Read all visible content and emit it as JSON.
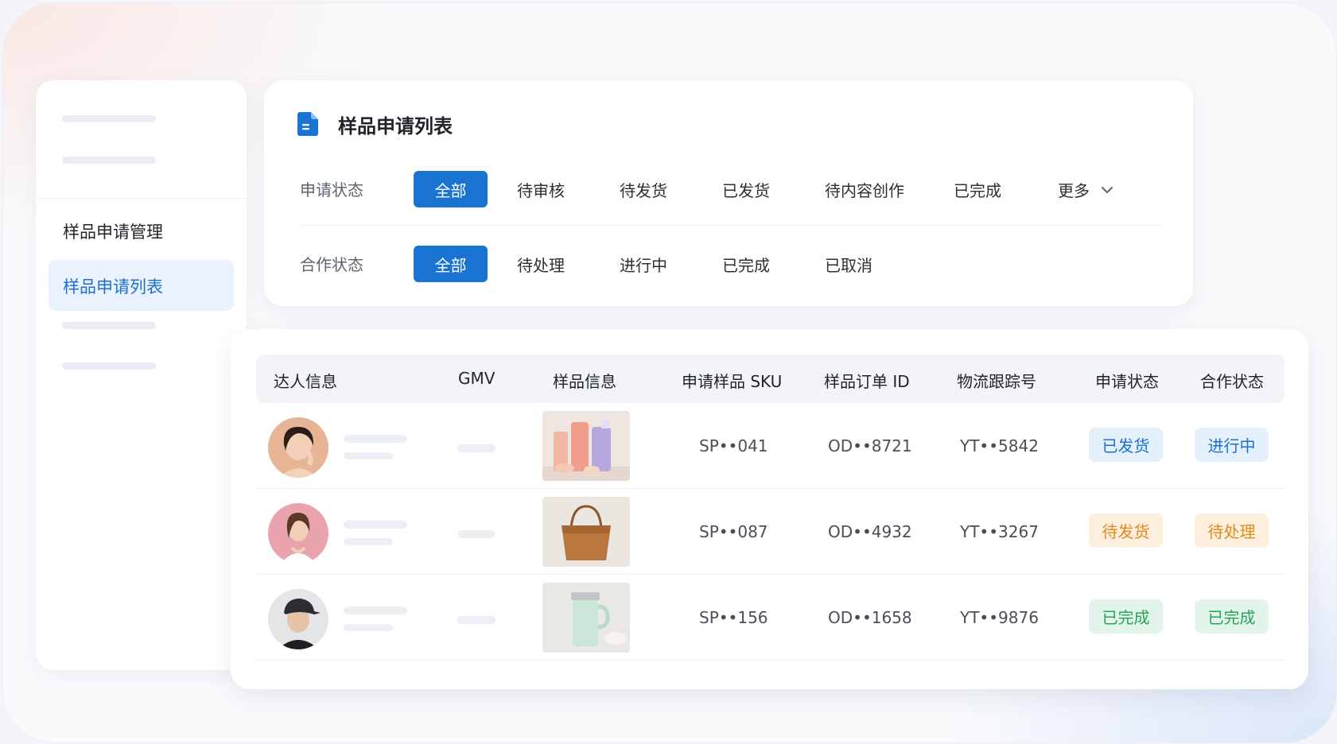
{
  "sidebar": {
    "group_title": "样品申请管理",
    "active_item": "样品申请列表"
  },
  "filters": {
    "title": "样品申请列表",
    "apply_status": {
      "label": "申请状态",
      "options": [
        "全部",
        "待审核",
        "待发货",
        "已发货",
        "待内容创作",
        "已完成"
      ],
      "selected": "全部",
      "more": "更多"
    },
    "coop_status": {
      "label": "合作状态",
      "options": [
        "全部",
        "待处理",
        "进行中",
        "已完成",
        "已取消"
      ],
      "selected": "全部"
    }
  },
  "table": {
    "columns": [
      "达人信息",
      "GMV",
      "样品信息",
      "申请样品 SKU",
      "样品订单 ID",
      "物流跟踪号",
      "申请状态",
      "合作状态"
    ],
    "rows": [
      {
        "sku": "SP••041",
        "order_id": "OD••8721",
        "tracking": "YT••5842",
        "apply_status": "已发货",
        "apply_color": "blue",
        "coop_status": "进行中",
        "coop_color": "blue",
        "product": "cosmetics",
        "avatar": "woman-1"
      },
      {
        "sku": "SP••087",
        "order_id": "OD••4932",
        "tracking": "YT••3267",
        "apply_status": "待发货",
        "apply_color": "orange",
        "coop_status": "待处理",
        "coop_color": "orange",
        "product": "tote-bag",
        "avatar": "woman-2"
      },
      {
        "sku": "SP••156",
        "order_id": "OD••1658",
        "tracking": "YT••9876",
        "apply_status": "已完成",
        "apply_color": "green",
        "coop_status": "已完成",
        "coop_color": "green",
        "product": "tumbler",
        "avatar": "man-1"
      }
    ]
  },
  "colors": {
    "primary": "#1873d3",
    "status_blue": "#1f6fd0",
    "status_orange": "#e08a1e",
    "status_green": "#25a55a"
  }
}
